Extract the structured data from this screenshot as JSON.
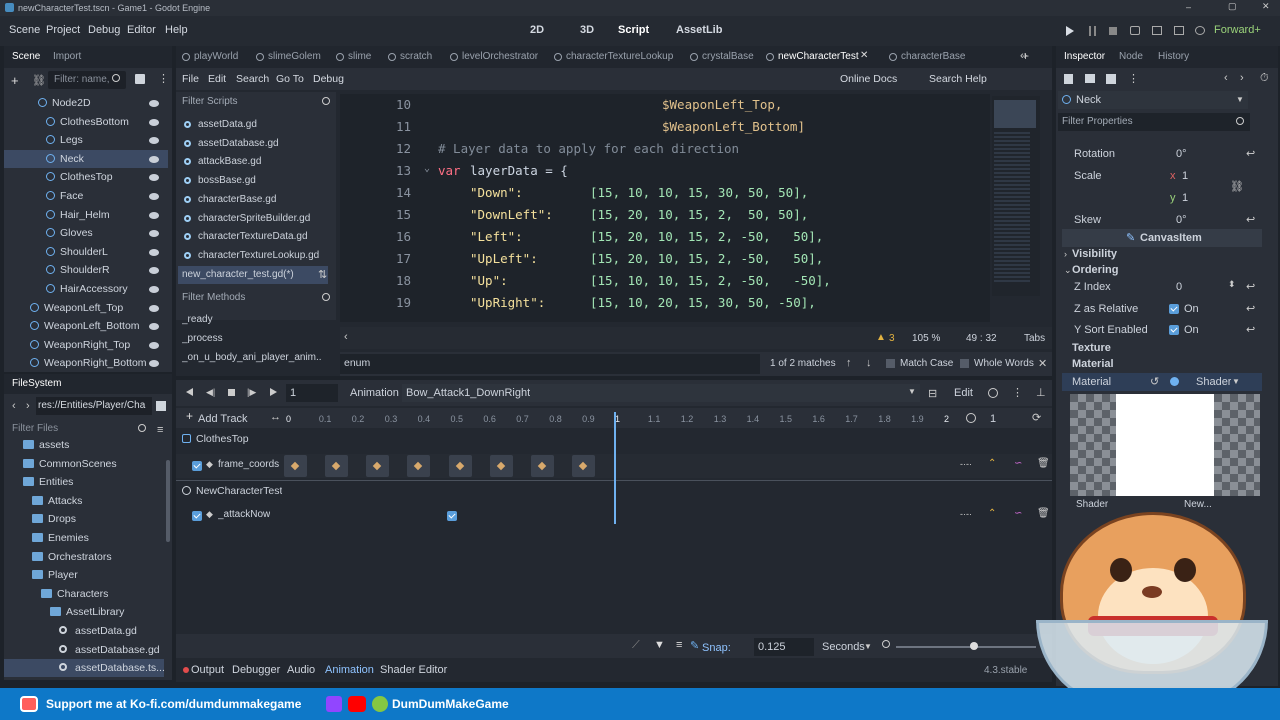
{
  "window": {
    "title": "newCharacterTest.tscn - Game1 - Godot Engine"
  },
  "menu": {
    "items": [
      "Scene",
      "Project",
      "Debug",
      "Editor",
      "Help"
    ],
    "workspaces": [
      "2D",
      "3D",
      "Script",
      "AssetLib"
    ],
    "renderer": "Forward+"
  },
  "left_dock": {
    "tabs": [
      "Scene",
      "Import"
    ],
    "filter_placeholder": "Filter: name,",
    "tree": [
      {
        "label": "Node2D",
        "depth": 0
      },
      {
        "label": "ClothesBottom",
        "depth": 1
      },
      {
        "label": "Legs",
        "depth": 1
      },
      {
        "label": "Neck",
        "depth": 1,
        "selected": true
      },
      {
        "label": "ClothesTop",
        "depth": 1
      },
      {
        "label": "Face",
        "depth": 1
      },
      {
        "label": "Hair_Helm",
        "depth": 1
      },
      {
        "label": "Gloves",
        "depth": 1
      },
      {
        "label": "ShoulderL",
        "depth": 1
      },
      {
        "label": "ShoulderR",
        "depth": 1
      },
      {
        "label": "HairAccessory",
        "depth": 1
      },
      {
        "label": "WeaponLeft_Top",
        "depth": 0
      },
      {
        "label": "WeaponLeft_Bottom",
        "depth": 0
      },
      {
        "label": "WeaponRight_Top",
        "depth": 0
      },
      {
        "label": "WeaponRight_Bottom",
        "depth": 0
      }
    ]
  },
  "filesystem": {
    "title": "FileSystem",
    "path": "res://Entities/Player/Cha",
    "filter_placeholder": "Filter Files",
    "items": [
      {
        "label": "assets",
        "depth": 1
      },
      {
        "label": "CommonScenes",
        "depth": 1
      },
      {
        "label": "Entities",
        "depth": 1
      },
      {
        "label": "Attacks",
        "depth": 2
      },
      {
        "label": "Drops",
        "depth": 2
      },
      {
        "label": "Enemies",
        "depth": 2
      },
      {
        "label": "Orchestrators",
        "depth": 2
      },
      {
        "label": "Player",
        "depth": 2
      },
      {
        "label": "Characters",
        "depth": 3
      },
      {
        "label": "AssetLibrary",
        "depth": 4
      },
      {
        "label": "assetData.gd",
        "depth": 5
      },
      {
        "label": "assetDatabase.gd",
        "depth": 5
      },
      {
        "label": "assetDatabase.ts...",
        "depth": 5,
        "selected": true
      }
    ]
  },
  "script_tabs": [
    "playWorld",
    "slimeGolem",
    "slime",
    "scratch",
    "levelOrchestrator",
    "characterTextureLookup",
    "crystalBase",
    "newCharacterTest",
    "characterBase"
  ],
  "script_menu": [
    "File",
    "Edit",
    "Search",
    "Go To",
    "Debug"
  ],
  "script_links": {
    "online_docs": "Online Docs",
    "search_help": "Search Help"
  },
  "scripts_panel": {
    "filter_placeholder": "Filter Scripts",
    "files": [
      "assetData.gd",
      "assetDatabase.gd",
      "attackBase.gd",
      "bossBase.gd",
      "characterBase.gd",
      "characterSpriteBuilder.gd",
      "characterTextureData.gd",
      "characterTextureLookup.gd",
      "new_character_test.gd(*)"
    ],
    "methods_placeholder": "Filter Methods",
    "methods": [
      "_ready",
      "_process",
      "_on_u_body_ani_player_anim..."
    ]
  },
  "code": {
    "lines": [
      {
        "n": "10",
        "text": "$WeaponLeft_Top,",
        "type": "var",
        "indent": 15
      },
      {
        "n": "11",
        "text": "$WeaponLeft_Bottom]",
        "type": "var",
        "indent": 15
      },
      {
        "n": "12",
        "text": "# Layer data to apply for each direction",
        "type": "cm",
        "indent": 0
      },
      {
        "n": "13",
        "kw": "var",
        "text": "layerData = {",
        "type": "decl",
        "indent": 0
      },
      {
        "n": "14",
        "key": "\"Down\":",
        "vals": "[15, 10, 10, 15, 30, 50, 50],"
      },
      {
        "n": "15",
        "key": "\"DownLeft\":",
        "vals": "[15, 20, 10, 15, 2,  50, 50],"
      },
      {
        "n": "16",
        "key": "\"Left\":",
        "vals": "[15, 20, 10, 15, 2, -50,   50],"
      },
      {
        "n": "17",
        "key": "\"UpLeft\":",
        "vals": "[15, 20, 10, 15, 2, -50,   50],"
      },
      {
        "n": "18",
        "key": "\"Up\":",
        "vals": "[15, 10, 10, 15, 2, -50,   -50],"
      },
      {
        "n": "19",
        "key": "\"UpRight\":",
        "vals": "[15, 10, 20, 15, 30, 50, -50],"
      }
    ],
    "warnings": "3",
    "zoom": "105 %",
    "cursor": "49 :  32",
    "indent_mode": "Tabs"
  },
  "search": {
    "value": "enum",
    "matches": "1 of 2 matches",
    "match_case": "Match Case",
    "whole_words": "Whole Words"
  },
  "animation": {
    "label": "Animation",
    "current": "Bow_Attack1_DownRight",
    "edit": "Edit",
    "add_track": "Add Track",
    "length": "1",
    "ticks": [
      "0",
      "0.1",
      "0.2",
      "0.3",
      "0.4",
      "0.5",
      "0.6",
      "0.7",
      "0.8",
      "0.9",
      "1",
      "1.1",
      "1.2",
      "1.3",
      "1.4",
      "1.5",
      "1.6",
      "1.7",
      "1.8",
      "1.9",
      "2"
    ],
    "step": "1",
    "playhead": 1.0,
    "groups": [
      {
        "node": "ClothesTop",
        "track": "frame_coords",
        "keys": [
          0.0,
          0.125,
          0.25,
          0.375,
          0.5,
          0.625,
          0.75,
          0.875
        ]
      },
      {
        "node": "NewCharacterTest",
        "track": "_attackNow",
        "keys": [
          0.5
        ]
      }
    ],
    "snap_label": "Snap:",
    "snap": "0.125",
    "snap_unit": "Seconds"
  },
  "bottom_tabs": [
    "Output",
    "Debugger",
    "Audio",
    "Animation",
    "Shader Editor"
  ],
  "version": "4.3.stable",
  "inspector": {
    "tabs": [
      "Inspector",
      "Node",
      "History"
    ],
    "node": "Neck",
    "filter_placeholder": "Filter Properties",
    "rotation_label": "Rotation",
    "rotation": "0°",
    "scale_label": "Scale",
    "scale_x_axis": "x",
    "scale_x": "1",
    "scale_y_axis": "y",
    "scale_y": "1",
    "skew_label": "Skew",
    "skew": "0°",
    "canvas_item": "CanvasItem",
    "sections": [
      "Visibility",
      "Ordering"
    ],
    "z_index_label": "Z Index",
    "z_index": "0",
    "z_relative_label": "Z as Relative",
    "z_relative": "On",
    "y_sort_label": "Y Sort Enabled",
    "y_sort": "On",
    "texture": "Texture",
    "material_section": "Material",
    "material_label": "Material",
    "material_value": "Shader",
    "shader_label": "Shader",
    "shader_value": "New..."
  },
  "banner": {
    "kofi": "Support me at Ko-fi.com/dumdummakegame",
    "channel": "DumDumMakeGame"
  }
}
